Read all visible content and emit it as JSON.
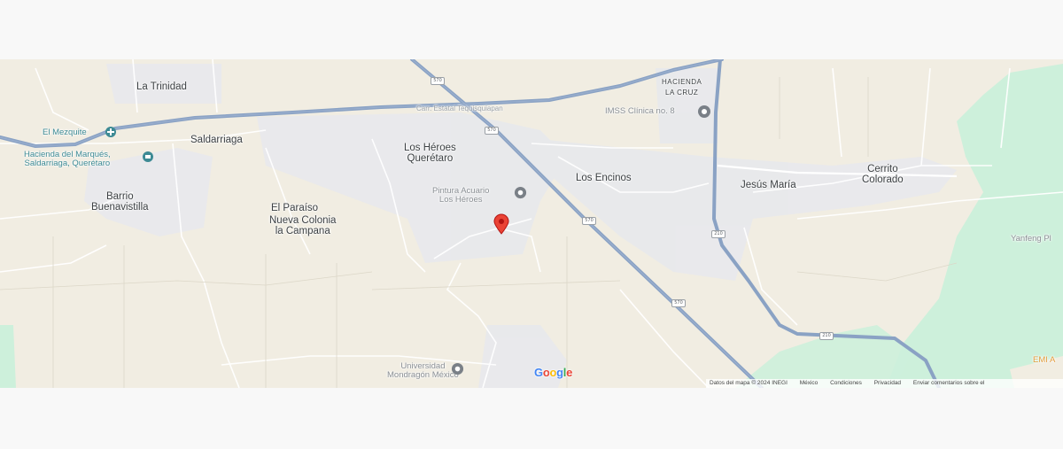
{
  "map": {
    "labels": {
      "la_trinidad": "La Trinidad",
      "hacienda_la_cruz_1": "HACIENDA",
      "hacienda_la_cruz_2": "LA CRUZ",
      "imss": "IMSS Clínica no. 8",
      "el_mezquite": "El Mezquite",
      "hacienda_marques_1": "Hacienda del Marqués,",
      "hacienda_marques_2": "Saldarriaga, Querétaro",
      "saldarriaga": "Saldarriaga",
      "los_heroes_1": "Los Héroes",
      "los_heroes_2": "Querétaro",
      "los_encinos": "Los Encinos",
      "jesus_maria": "Jesús María",
      "cerrito_1": "Cerrito",
      "cerrito_2": "Colorado",
      "barrio_1": "Barrio",
      "barrio_2": "Buenavistilla",
      "el_paraiso": "El Paraíso",
      "nueva_colonia_1": "Nueva Colonia",
      "nueva_colonia_2": "la Campana",
      "pintura_1": "Pintura Acuario",
      "pintura_2": "Los Héroes",
      "yanfeng": "Yanfeng Pl",
      "universidad_1": "Universidad",
      "universidad_2": "Mondragón México",
      "emi": "EMI A",
      "highway_name": "Carr. Estatal Tequisquiapan"
    },
    "shields": [
      "570",
      "570",
      "570",
      "570",
      "210",
      "210"
    ],
    "colors": {
      "land": "#f1ede2",
      "green_area": "#cdf0db",
      "highway": "#8aa2c4",
      "road": "#ffffff",
      "pin": "#ea4335"
    }
  },
  "branding": {
    "google": [
      "G",
      "o",
      "o",
      "g",
      "l",
      "e"
    ]
  },
  "footer": {
    "map_data": "Datos del mapa © 2024 INEGI",
    "country": "México",
    "terms": "Condiciones",
    "privacy": "Privacidad",
    "feedback": "Enviar comentarios sobre el"
  }
}
